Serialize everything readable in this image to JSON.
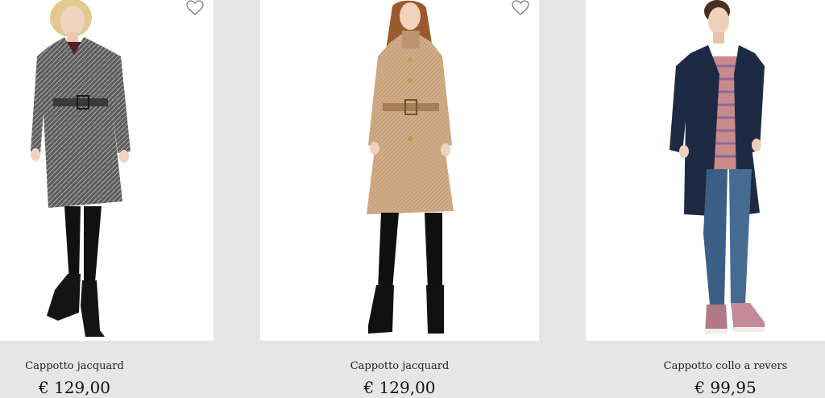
{
  "products": [
    {
      "name": "Cappotto jacquard",
      "price": "€ 129,00",
      "wishlist_icon": "heart-outline-icon",
      "coat_color": "#5b5b5b"
    },
    {
      "name": "Cappotto jacquard",
      "price": "€ 129,00",
      "wishlist_icon": "heart-outline-icon",
      "coat_color": "#c8a27c"
    },
    {
      "name": "Cappotto collo a revers",
      "price": "€ 99,95",
      "coat_color": "#1e2a44"
    }
  ],
  "colors": {
    "accent_green": "#2e9e4a",
    "card_background": "#ffffff",
    "page_background": "#e6e6e6"
  }
}
